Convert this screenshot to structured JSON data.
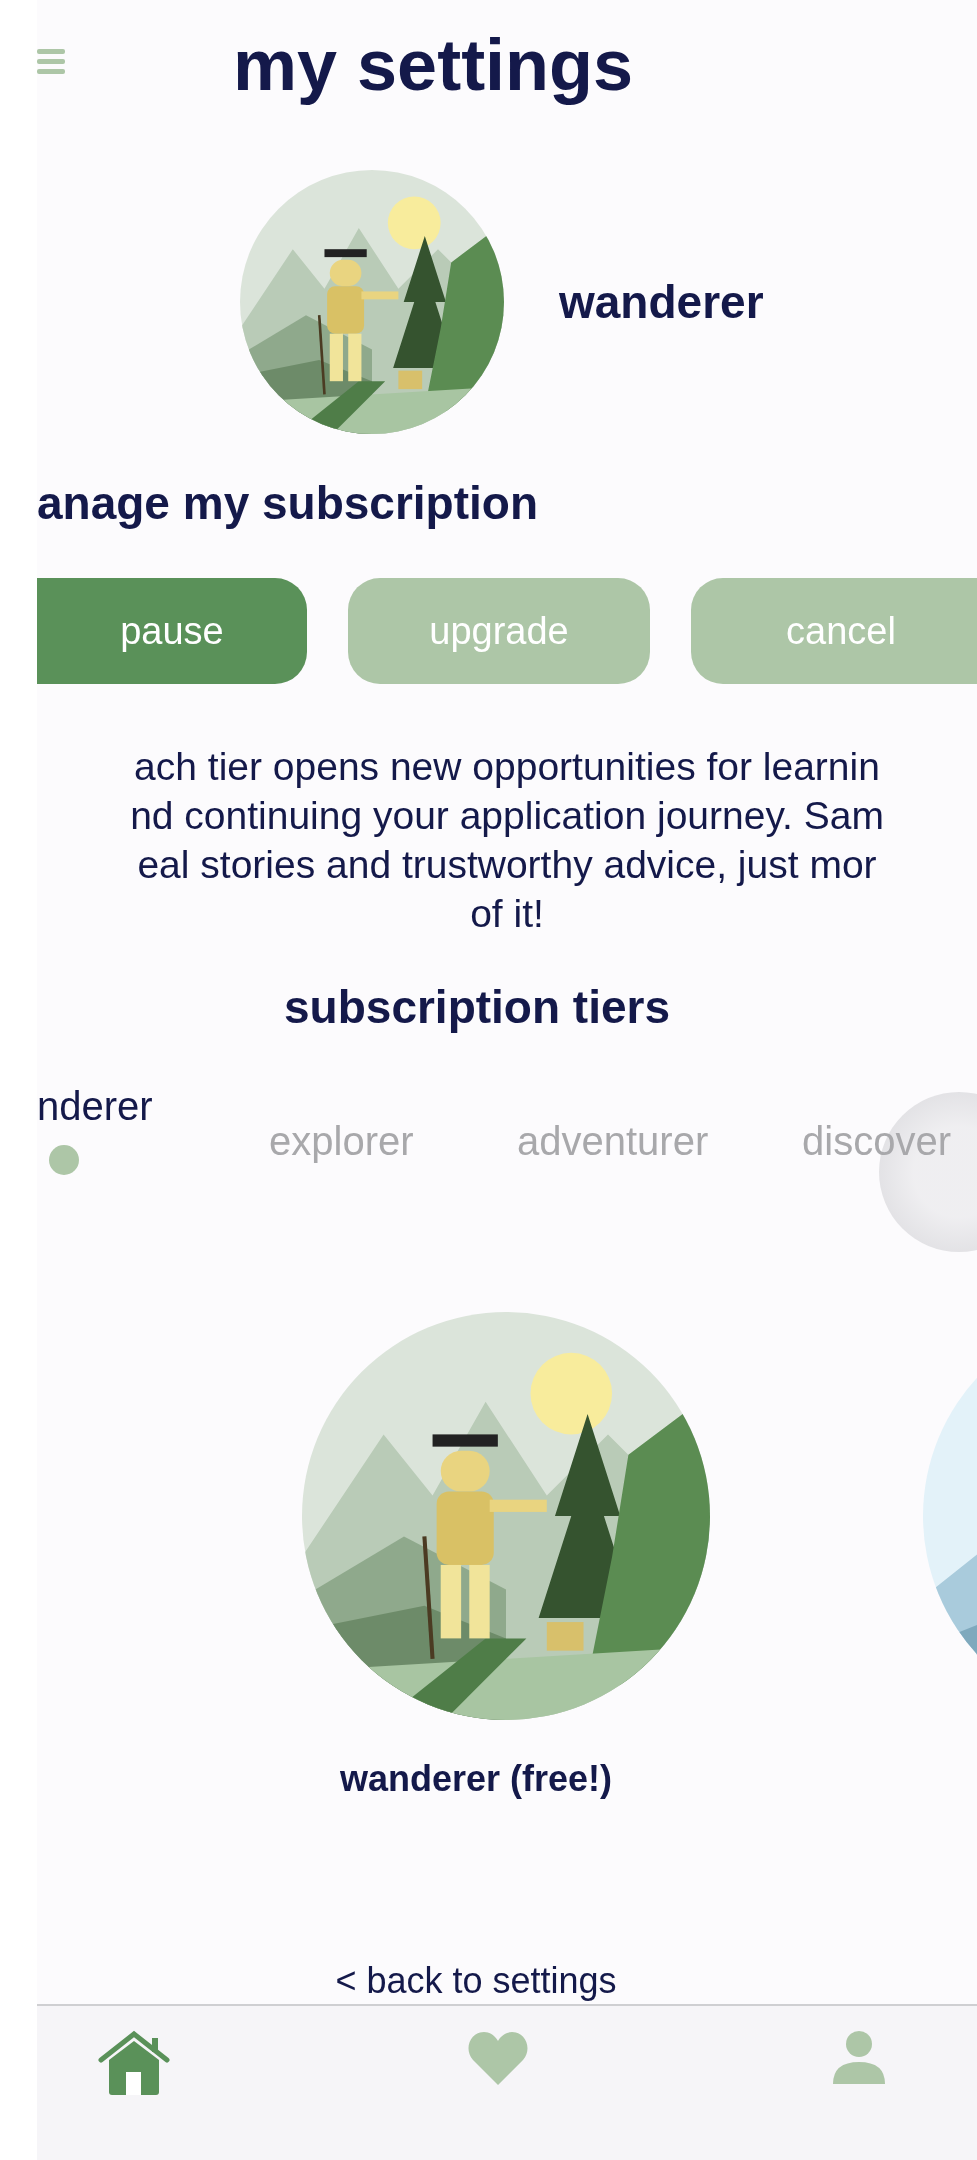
{
  "header": {
    "title": "my settings"
  },
  "profile": {
    "tier_name": "wanderer"
  },
  "subscription": {
    "heading": "anage my subscription",
    "buttons": [
      {
        "label": "pause",
        "selected": true
      },
      {
        "label": "upgrade",
        "selected": false
      },
      {
        "label": "cancel",
        "selected": false
      }
    ],
    "description_lines": [
      "ach tier opens new opportunities for learnin",
      "nd continuing your application journey. Sam",
      "eal stories and trustworthy advice, just mor",
      "of it!"
    ]
  },
  "tiers": {
    "heading": "subscription tiers",
    "items": [
      {
        "label": "nderer",
        "selected": true
      },
      {
        "label": "explorer",
        "selected": false
      },
      {
        "label": "adventurer",
        "selected": false
      },
      {
        "label": "discover",
        "selected": false
      }
    ],
    "caption": "wanderer (free!)"
  },
  "back_link": "< back to settings",
  "nav": [
    {
      "kind": "home",
      "selected": true
    },
    {
      "kind": "heart",
      "selected": false
    },
    {
      "kind": "person",
      "selected": false
    }
  ]
}
